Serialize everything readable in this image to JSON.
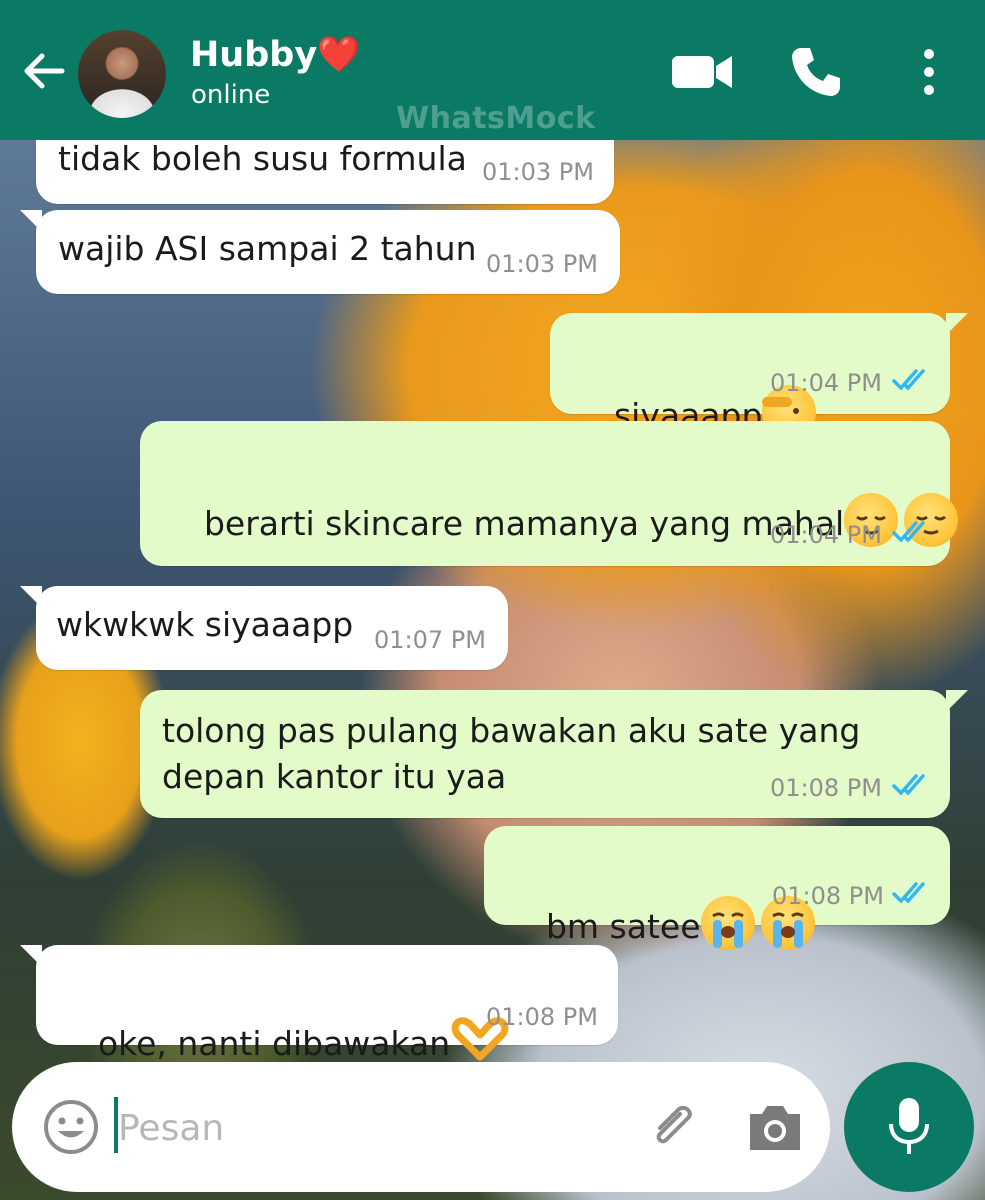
{
  "header": {
    "contact_name": "Hubby❤️",
    "status": "online",
    "watermark": "WhatsMock"
  },
  "colors": {
    "header_bg": "#0a7a64",
    "outgoing_bubble": "#e2fbc9",
    "incoming_bubble": "#ffffff",
    "read_ticks": "#34b7f1"
  },
  "messages": [
    {
      "direction": "incoming",
      "text": "tidak boleh susu formula",
      "time": "01:03 PM"
    },
    {
      "direction": "incoming",
      "text": "wajib ASI sampai 2 tahun",
      "time": "01:03 PM"
    },
    {
      "direction": "outgoing",
      "text": "siyaaapp",
      "emoji": [
        "saluting-face"
      ],
      "time": "01:04 PM",
      "status": "read"
    },
    {
      "direction": "outgoing",
      "text": "berarti skincare mamanya yang mahal",
      "emoji": [
        "relieved-face",
        "relieved-face"
      ],
      "time": "01:04 PM",
      "status": "read"
    },
    {
      "direction": "incoming",
      "text": "wkwkwk siyaaapp",
      "time": "01:07 PM"
    },
    {
      "direction": "outgoing",
      "text": "tolong pas pulang bawakan aku sate yang\ndepan kantor itu yaa",
      "time": "01:08 PM",
      "status": "read"
    },
    {
      "direction": "outgoing",
      "text": "bm satee",
      "emoji": [
        "loudly-crying-face",
        "loudly-crying-face"
      ],
      "time": "01:08 PM",
      "status": "read"
    },
    {
      "direction": "incoming",
      "text": "oke, nanti dibawakan",
      "emoji": [
        "heart-hands"
      ],
      "time": "01:08 PM"
    }
  ],
  "input": {
    "placeholder": "Pesan",
    "value": ""
  }
}
